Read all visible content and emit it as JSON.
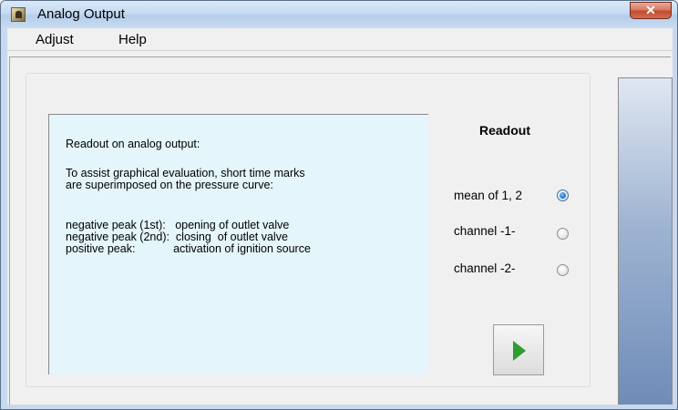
{
  "window": {
    "title": "Analog Output",
    "app_icon": "app-icon",
    "close_icon": "close-icon"
  },
  "menu": {
    "adjust": "Adjust",
    "help": "Help"
  },
  "info": {
    "lines": [
      "Readout on analog output:",
      "To assist graphical evaluation, short time marks",
      "are superimposed on the pressure curve:",
      "negative peak (1st):   opening of outlet valve",
      "negative peak (2nd):  closing  of outlet valve",
      "positive peak:            activation of ignition source"
    ]
  },
  "readout": {
    "title": "Readout",
    "options": [
      {
        "label": "mean of  1, 2",
        "selected": true
      },
      {
        "label": "channel  -1-",
        "selected": false
      },
      {
        "label": "channel  -2-",
        "selected": false
      }
    ]
  },
  "button": {
    "icon": "play-icon",
    "color": "#2e9e2e"
  }
}
